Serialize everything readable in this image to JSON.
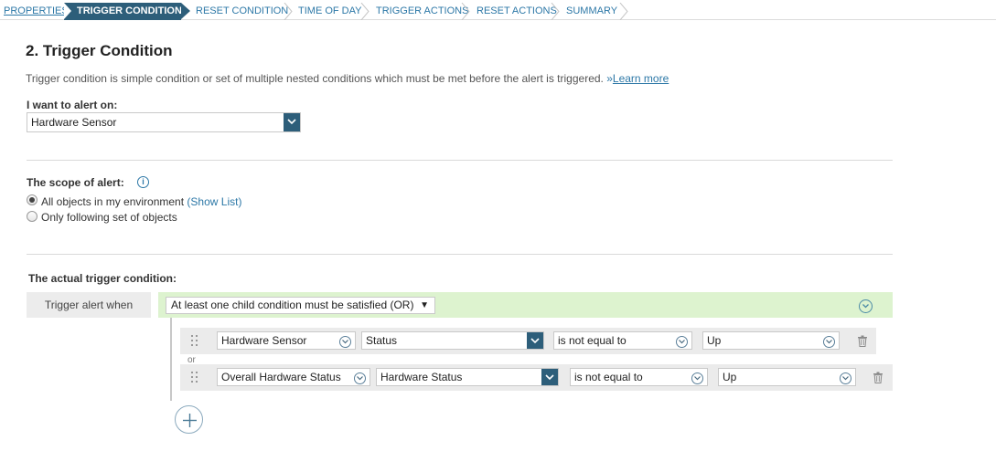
{
  "wizard": {
    "steps": [
      {
        "label": "PROPERTIES"
      },
      {
        "label": "TRIGGER CONDITION"
      },
      {
        "label": "RESET CONDITION"
      },
      {
        "label": "TIME OF DAY"
      },
      {
        "label": "TRIGGER ACTIONS"
      },
      {
        "label": "RESET ACTIONS"
      },
      {
        "label": "SUMMARY"
      }
    ],
    "active_step": "TRIGGER CONDITION"
  },
  "page": {
    "title": "2. Trigger Condition",
    "description": "Trigger condition is simple condition or set of multiple nested conditions which must be met before the alert is triggered.",
    "learn_more_prefix": "»",
    "learn_more": "Learn more"
  },
  "alert_on": {
    "label": "I want to alert on:",
    "value": "Hardware Sensor"
  },
  "scope": {
    "label": "The scope of alert:",
    "options": [
      {
        "label": "All objects in my environment",
        "link": "(Show List)",
        "checked": true
      },
      {
        "label": "Only following set of objects",
        "checked": false
      }
    ]
  },
  "trigger": {
    "label": "The actual trigger condition:",
    "when_label": "Trigger alert when",
    "group_condition": "At least one child condition must be satisfied (OR)",
    "caret": "▼",
    "or_separator": "or",
    "conditions": [
      {
        "object": "Hardware Sensor",
        "field": "Status",
        "operator": "is not equal to",
        "value": "Up"
      },
      {
        "object": "Overall Hardware Status",
        "field": "Hardware Status",
        "operator": "is not equal to",
        "value": "Up"
      }
    ]
  },
  "colors": {
    "accent": "#2d5e7a",
    "link": "#2d78a7",
    "group_bg": "#ddf3cf"
  }
}
